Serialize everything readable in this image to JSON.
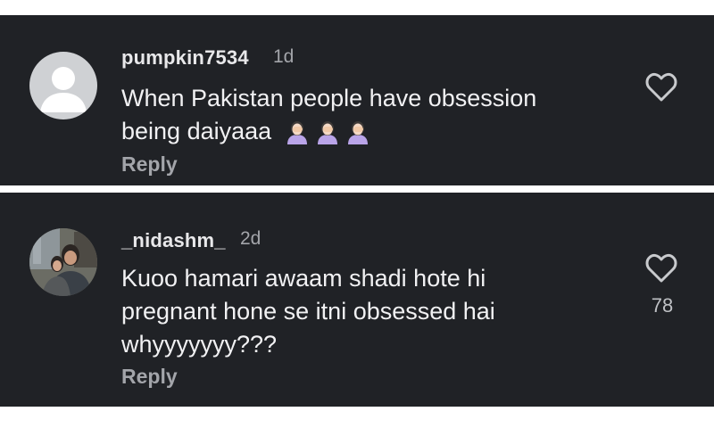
{
  "comments": [
    {
      "username": "pumpkin7534",
      "time": "1d",
      "text": "When Pakistan people have obsession being daiyaaa",
      "emoji": [
        "face-palm",
        "face-palm",
        "face-palm"
      ],
      "reply_label": "Reply",
      "likes": null,
      "avatar": "default-avatar"
    },
    {
      "username": "_nidashm_",
      "time": "2d",
      "text_lines": [
        "Kuoo hamari awaam shadi hote hi",
        "pregnant hone se itni obsessed hai",
        "whyyyyyyy???"
      ],
      "reply_label": "Reply",
      "likes": "78",
      "avatar": "photo-avatar"
    }
  ],
  "colors": {
    "background": "#202226",
    "page": "#ffffff",
    "text": "#f1f1f3",
    "muted": "#a3a5aa",
    "heart_outline": "#c8cacd"
  }
}
